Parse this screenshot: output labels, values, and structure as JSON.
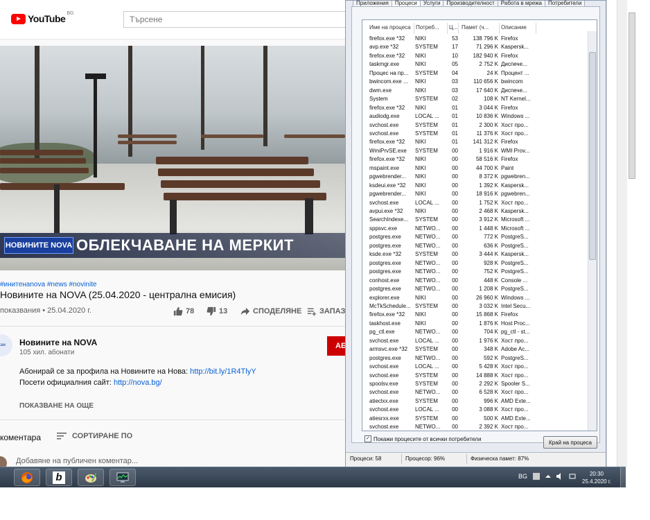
{
  "youtube": {
    "logo_word": "YouTube",
    "country": "BG",
    "search_placeholder": "Търсене",
    "overlay": {
      "channel_logo": "НОВИНИТЕ NOVA",
      "headline": "ОБЛЕКЧАВАНЕ НА МЕРКИТ"
    },
    "tags": "#инитенаnova #news #novinite",
    "title": "Новините на NOVA (25.04.2020 - централна емисия)",
    "views": "показвания • 25.04.2020 г.",
    "likes": "78",
    "dislikes": "13",
    "share": "СПОДЕЛЯНЕ",
    "save": "ЗАПАЗВ",
    "channel": {
      "avatar_text": "ntaw",
      "name": "Новините на NOVA",
      "subscribers": "105 хил. абонати",
      "subscribe_label": "АБ"
    },
    "description": {
      "line1_text": "Абонирай се за профила на Новините на Нова: ",
      "line1_link": "http://bit.ly/1R4TlyY",
      "line2_text": "Посети официалния сайт: ",
      "line2_link": "http://nova.bg/"
    },
    "show_more": "ПОКАЗВАНЕ НА ОЩЕ",
    "comments_label": "коментара",
    "sort_label": "СОРТИРАНЕ ПО",
    "comment_placeholder": "Добавяне на публичен коментар..."
  },
  "task_manager": {
    "tabs": [
      "Приложения",
      "Процеси",
      "Услуги",
      "Производителност",
      "Работа в мрежа",
      "Потребители"
    ],
    "active_tab": "Процеси",
    "columns": [
      "Име на процеса",
      "Потреб...",
      "Ц...",
      "Памет (ч...",
      "Описание"
    ],
    "processes": [
      [
        "firefox.exe *32",
        "NIKI",
        "53",
        "138 796 K",
        "Firefox"
      ],
      [
        "avp.exe *32",
        "SYSTEM",
        "17",
        "71 296 K",
        "Kaspersk..."
      ],
      [
        "firefox.exe *32",
        "NIKI",
        "10",
        "182 940 K",
        "Firefox"
      ],
      [
        "taskmgr.exe",
        "NIKI",
        "05",
        "2 752 K",
        "Диспече..."
      ],
      [
        "Процес на пр...",
        "SYSTEM",
        "04",
        "24 K",
        "Процент ..."
      ],
      [
        "bwincom.exe ...",
        "NIKI",
        "03",
        "110 656 K",
        "bwincom"
      ],
      [
        "dwm.exe",
        "NIKI",
        "03",
        "17 640 K",
        "Диспече..."
      ],
      [
        "System",
        "SYSTEM",
        "02",
        "108 K",
        "NT Kernel..."
      ],
      [
        "firefox.exe *32",
        "NIKI",
        "01",
        "3 044 K",
        "Firefox"
      ],
      [
        "audiodg.exe",
        "LOCAL ...",
        "01",
        "10 836 K",
        "Windows ..."
      ],
      [
        "svchost.exe",
        "SYSTEM",
        "01",
        "2 300 K",
        "Хост про..."
      ],
      [
        "svchost.exe",
        "SYSTEM",
        "01",
        "11 376 K",
        "Хост про..."
      ],
      [
        "firefox.exe *32",
        "NIKI",
        "01",
        "141 312 K",
        "Firefox"
      ],
      [
        "WmiPrvSE.exe",
        "SYSTEM",
        "00",
        "1 916 K",
        "WMI Prov..."
      ],
      [
        "firefox.exe *32",
        "NIKI",
        "00",
        "58 516 K",
        "Firefox"
      ],
      [
        "mspaint.exe",
        "NIKI",
        "00",
        "44 700 K",
        "Paint"
      ],
      [
        "pgwebrender...",
        "NIKI",
        "00",
        "8 372 K",
        "pgwebren..."
      ],
      [
        "ksdeui.exe *32",
        "NIKI",
        "00",
        "1 392 K",
        "Kaspersk..."
      ],
      [
        "pgwebrender...",
        "NIKI",
        "00",
        "18 916 K",
        "pgwebren..."
      ],
      [
        "svchost.exe",
        "LOCAL ...",
        "00",
        "1 752 K",
        "Хост про..."
      ],
      [
        "avpui.exe *32",
        "NIKI",
        "00",
        "2 468 K",
        "Kaspersk..."
      ],
      [
        "SearchIndexe...",
        "SYSTEM",
        "00",
        "3 912 K",
        "Microsoft ..."
      ],
      [
        "sppsvc.exe",
        "NETWO...",
        "00",
        "1 448 K",
        "Microsoft ..."
      ],
      [
        "postgres.exe",
        "NETWO...",
        "00",
        "772 K",
        "PostgreS..."
      ],
      [
        "postgres.exe",
        "NETWO...",
        "00",
        "636 K",
        "PostgreS..."
      ],
      [
        "ksde.exe *32",
        "SYSTEM",
        "00",
        "3 444 K",
        "Kaspersk..."
      ],
      [
        "postgres.exe",
        "NETWO...",
        "00",
        "928 K",
        "PostgreS..."
      ],
      [
        "postgres.exe",
        "NETWO...",
        "00",
        "752 K",
        "PostgreS..."
      ],
      [
        "conhost.exe",
        "NETWO...",
        "00",
        "448 K",
        "Console ..."
      ],
      [
        "postgres.exe",
        "NETWO...",
        "00",
        "1 208 K",
        "PostgreS..."
      ],
      [
        "explorer.exe",
        "NIKI",
        "00",
        "26 960 K",
        "Windows ..."
      ],
      [
        "McTkSchedule...",
        "SYSTEM",
        "00",
        "3 032 K",
        "Intel Secu..."
      ],
      [
        "firefox.exe *32",
        "NIKI",
        "00",
        "15 868 K",
        "Firefox"
      ],
      [
        "taskhost.exe",
        "NIKI",
        "00",
        "1 876 K",
        "Host Proc..."
      ],
      [
        "pg_ctl.exe",
        "NETWO...",
        "00",
        "704 K",
        "pg_ctl - st..."
      ],
      [
        "svchost.exe",
        "LOCAL ...",
        "00",
        "1 976 K",
        "Хост про..."
      ],
      [
        "armsvc.exe *32",
        "SYSTEM",
        "00",
        "348 K",
        "Adobe Ac..."
      ],
      [
        "postgres.exe",
        "NETWO...",
        "00",
        "592 K",
        "PostgreS..."
      ],
      [
        "svchost.exe",
        "LOCAL ...",
        "00",
        "5 428 K",
        "Хост про..."
      ],
      [
        "svchost.exe",
        "SYSTEM",
        "00",
        "14 888 K",
        "Хост про..."
      ],
      [
        "spoolsv.exe",
        "SYSTEM",
        "00",
        "2 292 K",
        "Spooler S..."
      ],
      [
        "svchost.exe",
        "NETWO...",
        "00",
        "6 528 K",
        "Хост про..."
      ],
      [
        "atieclxx.exe",
        "SYSTEM",
        "00",
        "996 K",
        "AMD Exte..."
      ],
      [
        "svchost.exe",
        "LOCAL ...",
        "00",
        "3 088 K",
        "Хост про..."
      ],
      [
        "atiesrxx.exe",
        "SYSTEM",
        "00",
        "500 K",
        "AMD Exte..."
      ],
      [
        "svchost.exe",
        "NETWO...",
        "00",
        "2 392 K",
        "Хост про..."
      ]
    ],
    "show_all_label": "Покажи процесите от всички потребители",
    "end_process_label": "Край на процеса",
    "status": {
      "processes": "Процеси: 58",
      "cpu": "Процесор: 96%",
      "memory": "Физическа памет: 87%"
    }
  },
  "taskbar": {
    "lang": "BG",
    "time": "20:30",
    "date": "25.4.2020 г."
  }
}
